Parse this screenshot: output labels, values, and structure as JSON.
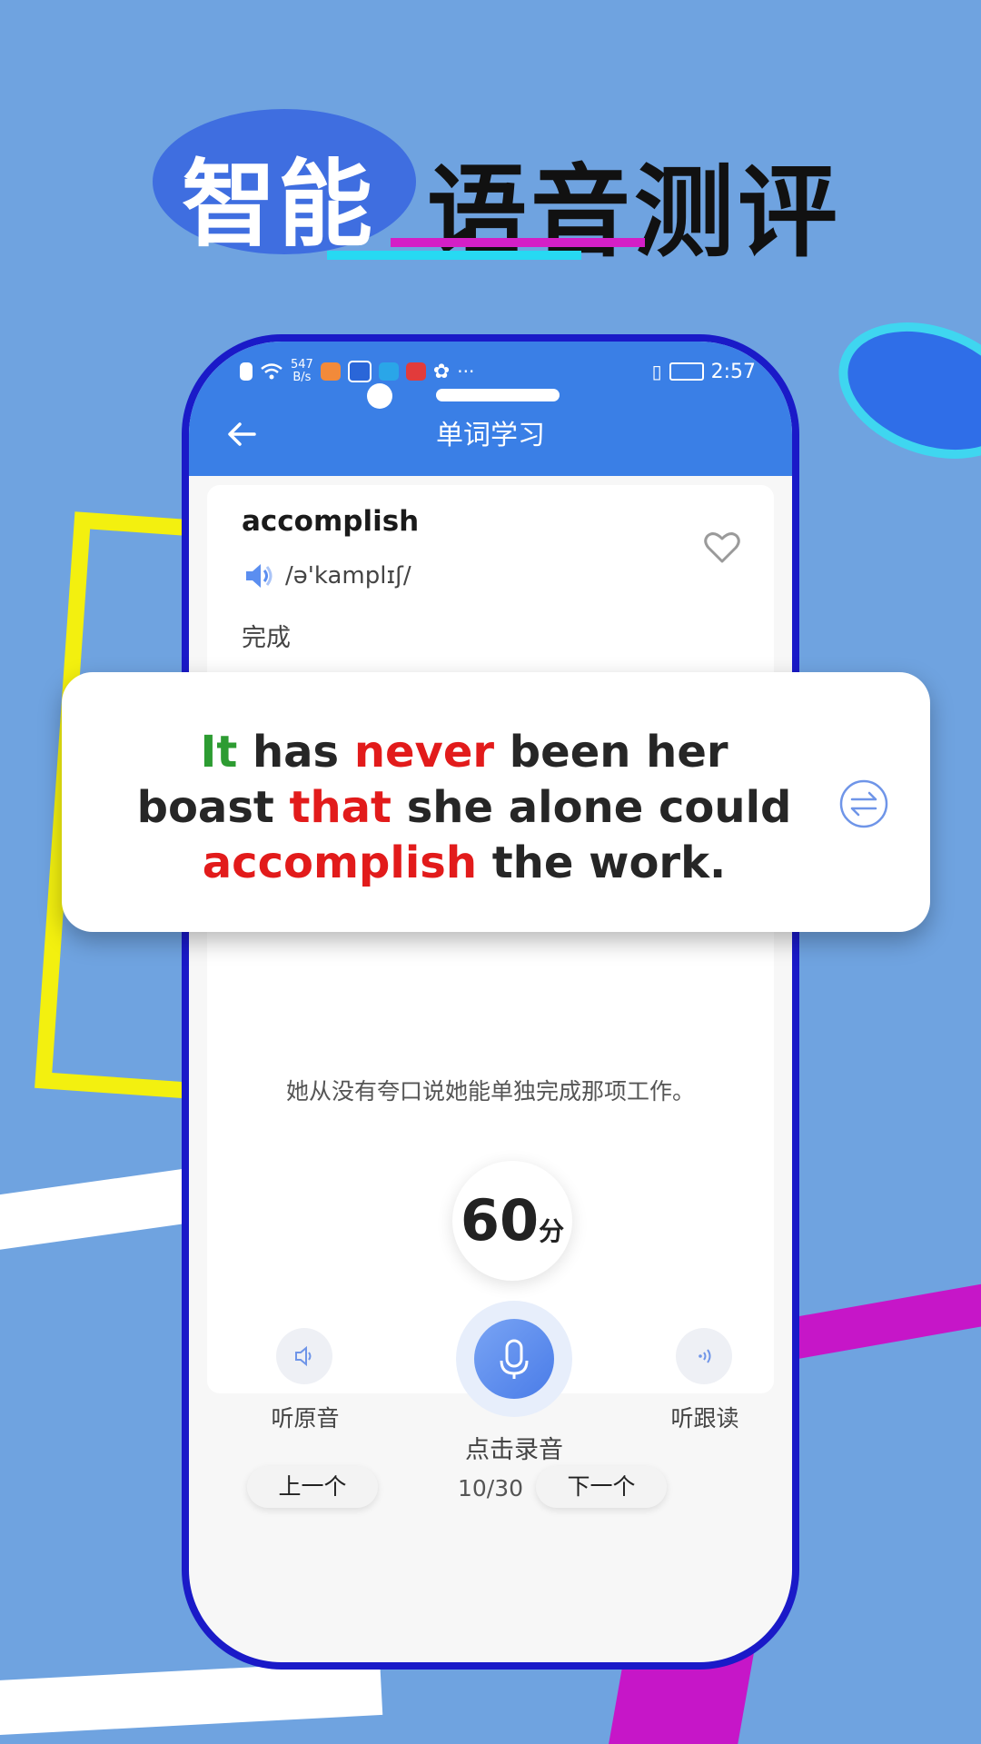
{
  "headline": {
    "part1": "智能",
    "part2": "语音测评"
  },
  "status_bar": {
    "speed": "547",
    "speed_unit": "B/s",
    "more": "···",
    "time": "2:57"
  },
  "nav": {
    "title": "单词学习"
  },
  "word_card": {
    "word": "accomplish",
    "phonetic": "/ə'kamplɪʃ/",
    "meaning": "完成"
  },
  "sentence": {
    "parts": [
      {
        "text": "It",
        "color": "#2d9c32"
      },
      {
        "text": " has ",
        "color": "#262626"
      },
      {
        "text": "never",
        "color": "#e21b1b"
      },
      {
        "text": " been her boast ",
        "color": "#262626"
      },
      {
        "text": "that",
        "color": "#e21b1b"
      },
      {
        "text": " she alone could ",
        "color": "#262626"
      },
      {
        "text": "accomplish",
        "color": "#e21b1b"
      },
      {
        "text": " the work.",
        "color": "#262626"
      }
    ],
    "translation": "她从没有夸口说她能单独完成那项工作。"
  },
  "score": {
    "value": "60",
    "unit": "分"
  },
  "controls": {
    "listen_original": "听原音",
    "record": "点击录音",
    "listen_followed": "听跟读"
  },
  "pager": {
    "prev": "上一个",
    "counter": "10/30",
    "next": "下一个"
  },
  "colors": {
    "primary": "#3a7fe6",
    "highlight_red": "#e21b1b",
    "highlight_green": "#2d9c32"
  }
}
